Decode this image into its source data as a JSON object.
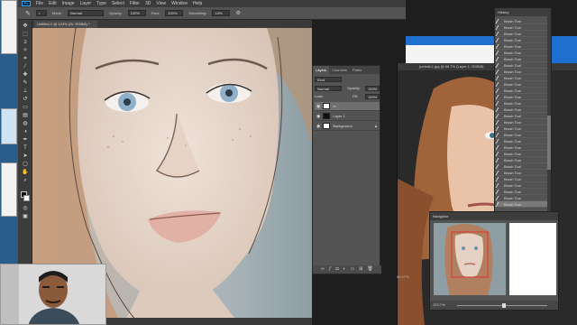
{
  "menubar": {
    "logo": "Ps",
    "items": [
      "File",
      "Edit",
      "Image",
      "Layer",
      "Type",
      "Select",
      "Filter",
      "3D",
      "View",
      "Window",
      "Help"
    ]
  },
  "options": {
    "mode_label": "Mode:",
    "mode_value": "Normal",
    "opacity_label": "Opacity:",
    "opacity_value": "100%",
    "flow_label": "Flow:",
    "flow_value": "100%",
    "smoothing_label": "Smoothing:",
    "smoothing_value": "10%"
  },
  "document": {
    "tab_title": "Untitled-1 @ 124% (Or, RGB/8) *"
  },
  "right_document": {
    "tab_title": "portrait-1.jpg @ 66.7% (Layer 1, RGB/8)"
  },
  "layers_panel": {
    "tabs": [
      "Layers",
      "Channels",
      "Paths"
    ],
    "kind": "Kind",
    "blend_mode": "Normal",
    "opacity_label": "Opacity:",
    "opacity_value": "100%",
    "lock_label": "Lock:",
    "fill_label": "Fill:",
    "fill_value": "100%",
    "layers": [
      {
        "name": "lo",
        "selected": true
      },
      {
        "name": "Layer 1",
        "selected": false
      },
      {
        "name": "Background",
        "selected": false
      }
    ],
    "footer_icons": [
      "link-icon",
      "fx-icon",
      "mask-icon",
      "adjustment-icon",
      "folder-icon",
      "new-layer-icon",
      "trash-icon"
    ]
  },
  "history_panel": {
    "title": "History",
    "items": [
      "Brush Tool",
      "Brush Tool",
      "Brush Tool",
      "Brush Tool",
      "Brush Tool",
      "Brush Tool",
      "Brush Tool",
      "Brush Tool",
      "Brush Tool",
      "Brush Tool",
      "Brush Tool",
      "Brush Tool",
      "Brush Tool",
      "Brush Tool",
      "Brush Tool",
      "Brush Tool",
      "Brush Tool",
      "Brush Tool",
      "Brush Tool",
      "Brush Tool",
      "Brush Tool",
      "Brush Tool",
      "Brush Tool",
      "Brush Tool",
      "Brush Tool",
      "Brush Tool",
      "Brush Tool",
      "Brush Tool",
      "Brush Tool",
      "Brush Tool"
    ]
  },
  "navigator": {
    "title": "Navigator",
    "zoom": "123.7%"
  },
  "left_zoom": "66.67%",
  "colors": {
    "ps_dark": "#3c3c3c",
    "panel": "#535353",
    "accent": "#31a8ff",
    "skin": "#e8d8cc",
    "hair": "#b07a4e"
  }
}
